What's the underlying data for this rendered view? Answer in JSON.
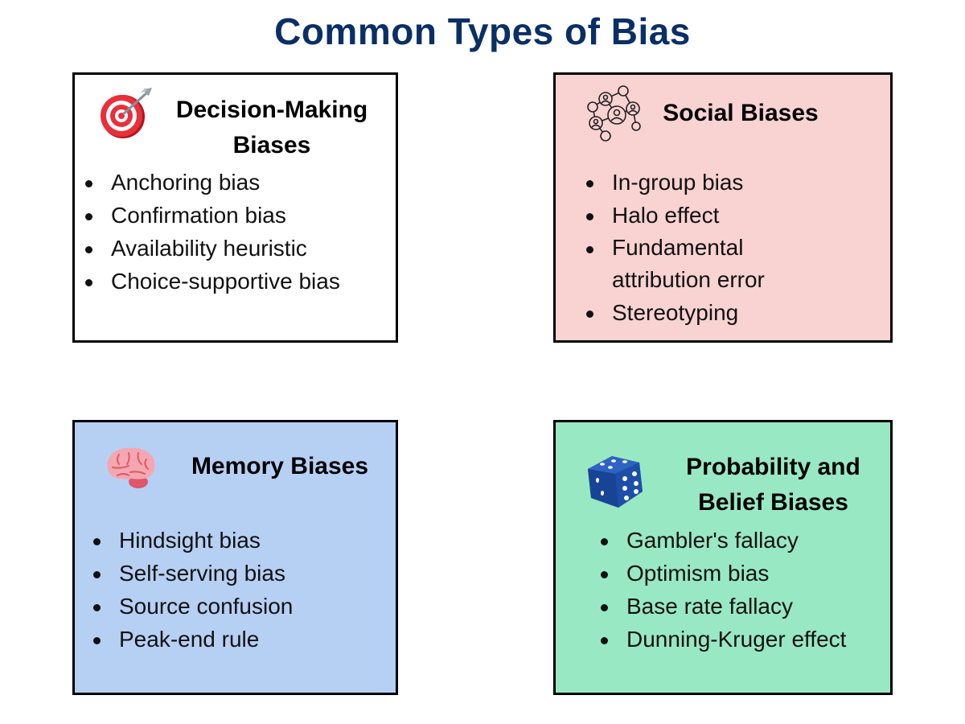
{
  "title": "Common Types of Bias",
  "colors": {
    "title": "#0a2f66",
    "decision_bg": "#ffffff",
    "social_bg": "#f9d2d2",
    "memory_bg": "#b6d0f4",
    "probability_bg": "#98e8c4"
  },
  "boxes": {
    "decision": {
      "icon": "target-icon",
      "heading_line1": "Decision-Making",
      "heading_line2": "Biases",
      "items": [
        "Anchoring bias",
        "Confirmation bias",
        "Availability heuristic",
        "Choice-supportive bias"
      ]
    },
    "social": {
      "icon": "social-network-icon",
      "heading": "Social Biases",
      "items": [
        "In-group bias",
        "Halo effect",
        "Fundamental attribution error",
        "Stereotyping"
      ]
    },
    "memory": {
      "icon": "brain-icon",
      "heading": "Memory Biases",
      "items": [
        "Hindsight bias",
        "Self-serving bias",
        "Source confusion",
        "Peak-end rule"
      ]
    },
    "probability": {
      "icon": "dice-icon",
      "heading_line1": "Probability and",
      "heading_line2": "Belief Biases",
      "items": [
        "Gambler's fallacy",
        "Optimism bias",
        "Base rate fallacy",
        "Dunning-Kruger effect"
      ]
    }
  }
}
